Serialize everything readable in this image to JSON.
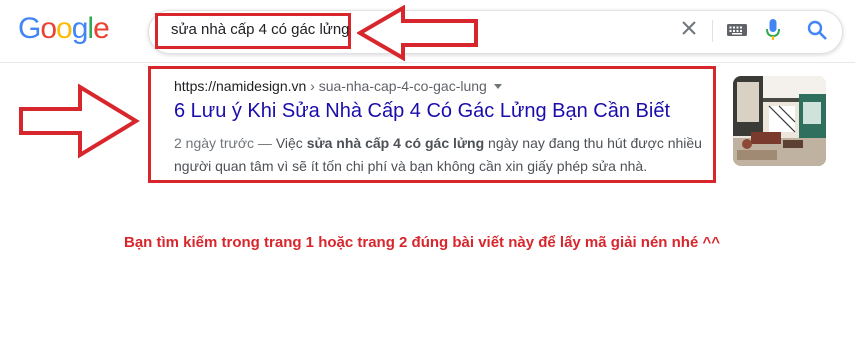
{
  "logo": {
    "text": "Google",
    "letters": [
      {
        "ch": "G",
        "color": "#4285F4"
      },
      {
        "ch": "o",
        "color": "#EA4335"
      },
      {
        "ch": "o",
        "color": "#FBBC05"
      },
      {
        "ch": "g",
        "color": "#4285F4"
      },
      {
        "ch": "l",
        "color": "#34A853"
      },
      {
        "ch": "e",
        "color": "#EA4335"
      }
    ]
  },
  "search": {
    "query": "sửa nhà cấp 4 có gác lửng"
  },
  "icons": {
    "clear": "close-icon",
    "keyboard": "keyboard-icon",
    "voice": "microphone-icon",
    "search": "search-icon"
  },
  "result": {
    "site": "https://namidesign.vn",
    "path": " › sua-nha-cap-4-co-gac-lung",
    "title": "6 Lưu ý Khi Sửa Nhà Cấp 4 Có Gác Lửng Bạn Cần Biết",
    "date": "2 ngày trước — ",
    "snippet_prefix": "Việc ",
    "snippet_bold": "sửa nhà cấp 4 có gác lửng",
    "snippet_suffix": " ngày nay đang thu hút được nhiều người quan tâm vì sẽ ít tốn chi phí và bạn không cần xin giấy phép sửa nhà."
  },
  "note": "Bạn tìm kiếm trong trang 1 hoặc trang 2 đúng bài viết này để lấy mã giải nén nhé ^^",
  "colors": {
    "annotation_red": "#d8262d",
    "link_blue": "#1a0dab"
  }
}
